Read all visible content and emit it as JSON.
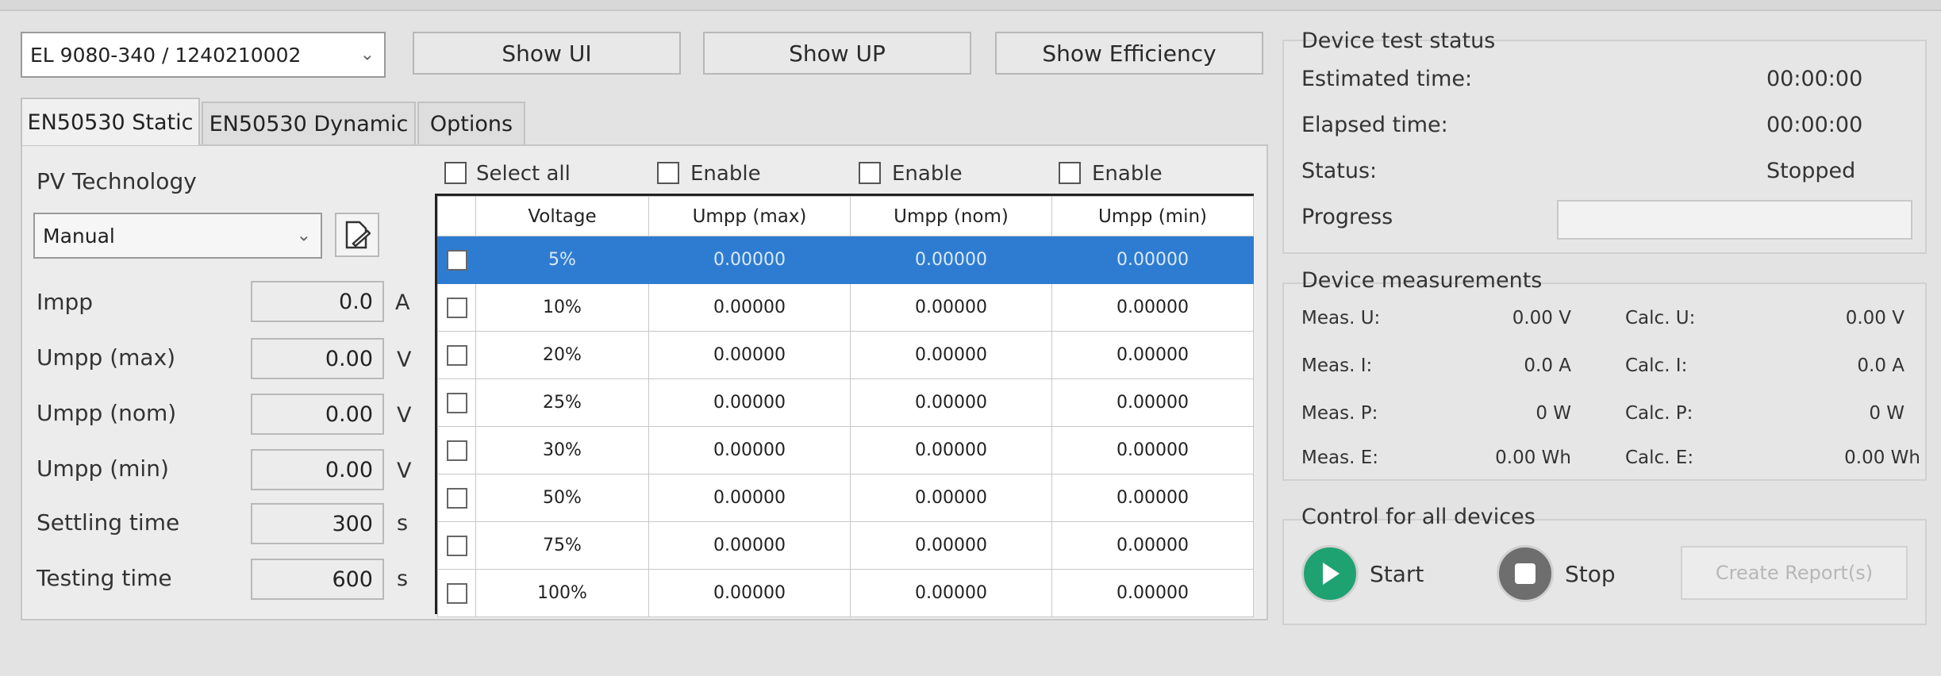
{
  "device_select": {
    "value": "EL 9080-340 / 1240210002"
  },
  "toolbar": {
    "show_ui": "Show UI",
    "show_up": "Show UP",
    "show_efficiency": "Show Efficiency"
  },
  "tabs": [
    {
      "label": "EN50530 Static",
      "active": true
    },
    {
      "label": "EN50530 Dynamic",
      "active": false
    },
    {
      "label": "Options",
      "active": false
    }
  ],
  "pv": {
    "title": "PV Technology",
    "technology": "Manual",
    "fields": [
      {
        "label": "Impp",
        "value": "0.0",
        "unit": "A"
      },
      {
        "label": "Umpp (max)",
        "value": "0.00",
        "unit": "V"
      },
      {
        "label": "Umpp (nom)",
        "value": "0.00",
        "unit": "V"
      },
      {
        "label": "Umpp (min)",
        "value": "0.00",
        "unit": "V"
      },
      {
        "label": "Settling time",
        "value": "300",
        "unit": "s"
      },
      {
        "label": "Testing time",
        "value": "600",
        "unit": "s"
      }
    ]
  },
  "grid": {
    "select_all": "Select all",
    "enable_labels": [
      "Enable",
      "Enable",
      "Enable"
    ],
    "headers": [
      "Voltage",
      "Umpp (max)",
      "Umpp (nom)",
      "Umpp (min)"
    ],
    "rows": [
      [
        "5%",
        "0.00000",
        "0.00000",
        "0.00000"
      ],
      [
        "10%",
        "0.00000",
        "0.00000",
        "0.00000"
      ],
      [
        "20%",
        "0.00000",
        "0.00000",
        "0.00000"
      ],
      [
        "25%",
        "0.00000",
        "0.00000",
        "0.00000"
      ],
      [
        "30%",
        "0.00000",
        "0.00000",
        "0.00000"
      ],
      [
        "50%",
        "0.00000",
        "0.00000",
        "0.00000"
      ],
      [
        "75%",
        "0.00000",
        "0.00000",
        "0.00000"
      ],
      [
        "100%",
        "0.00000",
        "0.00000",
        "0.00000"
      ]
    ]
  },
  "status": {
    "title": "Device test status",
    "estimated_label": "Estimated time:",
    "estimated_value": "00:00:00",
    "elapsed_label": "Elapsed time:",
    "elapsed_value": "00:00:00",
    "status_label": "Status:",
    "status_value": "Stopped",
    "progress_label": "Progress",
    "progress": 0
  },
  "measurements": {
    "title": "Device measurements",
    "meas_u_label": "Meas. U:",
    "meas_u": "0.00 V",
    "calc_u_label": "Calc. U:",
    "calc_u": "0.00 V",
    "meas_i_label": "Meas. I:",
    "meas_i": "0.0 A",
    "calc_i_label": "Calc. I:",
    "calc_i": "0.0 A",
    "meas_p_label": "Meas. P:",
    "meas_p": "0 W",
    "calc_p_label": "Calc. P:",
    "calc_p": "0 W",
    "meas_e_label": "Meas. E:",
    "meas_e": "0.00 Wh",
    "calc_e_label": "Calc. E:",
    "calc_e": "0.00 Wh"
  },
  "control": {
    "title": "Control for all devices",
    "start": "Start",
    "stop": "Stop",
    "report": "Create Report(s)"
  },
  "colors": {
    "selection": "#2e7cd1",
    "start_green": "#1fa272",
    "stop_gray": "#6e6e6e"
  }
}
